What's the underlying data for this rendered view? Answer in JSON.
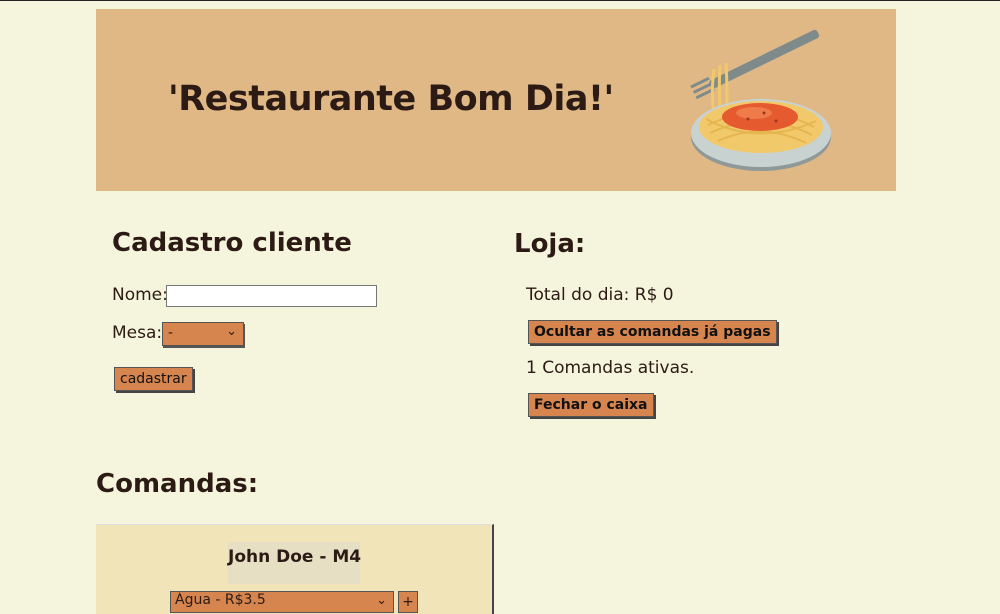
{
  "header": {
    "title": "'Restaurante Bom Dia!'",
    "image_icon": "spaghetti-plate-icon"
  },
  "cadastro": {
    "title": "Cadastro cliente",
    "nome_label": "Nome:",
    "nome_value": "",
    "mesa_label": "Mesa:",
    "mesa_selected": "-",
    "submit_label": "cadastrar"
  },
  "loja": {
    "title": "Loja:",
    "total_label": "Total do dia: R$ 0",
    "hide_paid_label": "Ocultar as comandas já pagas",
    "active_count_label": "1 Comandas ativas.",
    "close_register_label": "Fechar o caixa"
  },
  "comandas": {
    "title": "Comandas:",
    "items": [
      {
        "name": "John Doe - M4",
        "product_selected": "Água - R$3.5",
        "add_label": "+"
      }
    ]
  },
  "colors": {
    "background": "#f5f4dc",
    "header_bg": "#dfb886",
    "button_bg": "#d6854e",
    "card_bg": "#f0e4b8",
    "text": "#2c1a14"
  }
}
